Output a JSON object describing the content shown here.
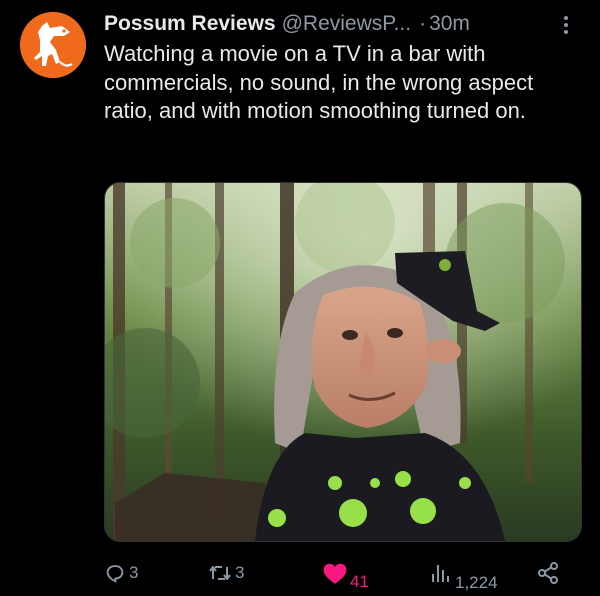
{
  "post": {
    "author": {
      "display_name": "Possum Reviews",
      "handle": "@ReviewsP...",
      "avatar_icon": "possum-icon"
    },
    "separator": "·",
    "time": "30m",
    "text": "Watching a movie on a TV in a bar with commercials, no sound, in the wrong aspect ratio, and with motion smoothing turned on.",
    "media_icon": "photo-image"
  },
  "actions": {
    "reply_count": "3",
    "retweet_count": "3",
    "like_count": "41",
    "views_count": "1,224"
  },
  "colors": {
    "background": "#000000",
    "text": "#e7e9ea",
    "secondary": "#8b98a5",
    "like": "#f91880",
    "avatar": "#f06a1d"
  }
}
